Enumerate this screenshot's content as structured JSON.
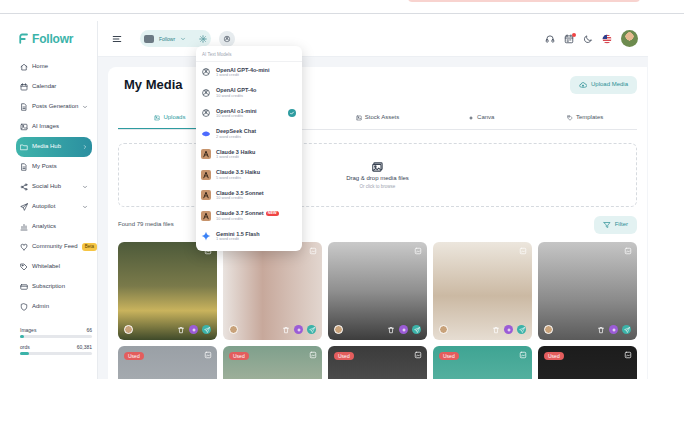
{
  "brand": {
    "name": "Followr"
  },
  "sidebar": {
    "items": [
      {
        "label": "Home",
        "selected": false,
        "expandable": false
      },
      {
        "label": "Calendar",
        "selected": false,
        "expandable": false
      },
      {
        "label": "Posts Generation",
        "selected": false,
        "expandable": true
      },
      {
        "label": "AI Images",
        "selected": false,
        "expandable": false
      },
      {
        "label": "Media Hub",
        "selected": true,
        "expandable": false
      },
      {
        "label": "My Posts",
        "selected": false,
        "expandable": false
      },
      {
        "label": "Social Hub",
        "selected": false,
        "expandable": true
      },
      {
        "label": "Autopilot",
        "selected": false,
        "expandable": true
      },
      {
        "label": "Analytics",
        "selected": false,
        "expandable": false
      },
      {
        "label": "Community Feed",
        "selected": false,
        "expandable": false,
        "badge": "Beta"
      },
      {
        "label": "Whitelabel",
        "selected": false,
        "expandable": false
      },
      {
        "label": "Subscription",
        "selected": false,
        "expandable": false
      },
      {
        "label": "Admin",
        "selected": false,
        "expandable": false
      }
    ],
    "usage": [
      {
        "label": "Images",
        "value": "66",
        "level": 0.06
      },
      {
        "label": "ords",
        "value": "60,381",
        "level": 0.12
      }
    ]
  },
  "header": {
    "workspace": "Followr",
    "notification_dot": true
  },
  "model_menu": {
    "title": "AI Text Models",
    "items": [
      {
        "name": "OpenAI GPT-4o-mini",
        "credits": "1 word credit",
        "kind": "openai",
        "selected": false
      },
      {
        "name": "OpenAI GPT-4o",
        "credits": "10 word credits",
        "kind": "openai",
        "selected": false
      },
      {
        "name": "OpenAI o1-mini",
        "credits": "10 word credits",
        "kind": "openai",
        "selected": true
      },
      {
        "name": "DeepSeek Chat",
        "credits": "2 word credits",
        "kind": "deepseek",
        "selected": false
      },
      {
        "name": "Claude 3 Haiku",
        "credits": "1 word credit",
        "kind": "claude",
        "selected": false
      },
      {
        "name": "Claude 3.5 Haiku",
        "credits": "5 word credits",
        "kind": "claude",
        "selected": false
      },
      {
        "name": "Claude 3.5 Sonnet",
        "credits": "10 word credits",
        "kind": "claude",
        "selected": false
      },
      {
        "name": "Claude 3.7 Sonnet",
        "credits": "10 word credits",
        "kind": "claude",
        "selected": false,
        "badge": "NEW"
      },
      {
        "name": "Gemini 1.5 Flash",
        "credits": "1 word credit",
        "kind": "gemini",
        "selected": false
      }
    ]
  },
  "page": {
    "title": "My Media",
    "upload_button": "Upload Media",
    "tabs": [
      {
        "label": "Uploads",
        "selected": true
      },
      {
        "label": "Stock Assets",
        "selected": false
      },
      {
        "label": "Canva",
        "selected": false
      },
      {
        "label": "Templates",
        "selected": false
      }
    ],
    "dropzone": {
      "title": "Drag & drop media files",
      "subtitle": "Or click to browse"
    },
    "count": "Found 79 media files",
    "filter_button": "Filter",
    "media": [
      {
        "used": false
      },
      {
        "used": false
      },
      {
        "used": false
      },
      {
        "used": false
      },
      {
        "used": false
      },
      {
        "used": true,
        "badge": "Used"
      },
      {
        "used": true,
        "badge": "Used"
      },
      {
        "used": true,
        "badge": "Used"
      },
      {
        "used": true,
        "badge": "Used"
      },
      {
        "used": true,
        "badge": "Used"
      }
    ]
  }
}
